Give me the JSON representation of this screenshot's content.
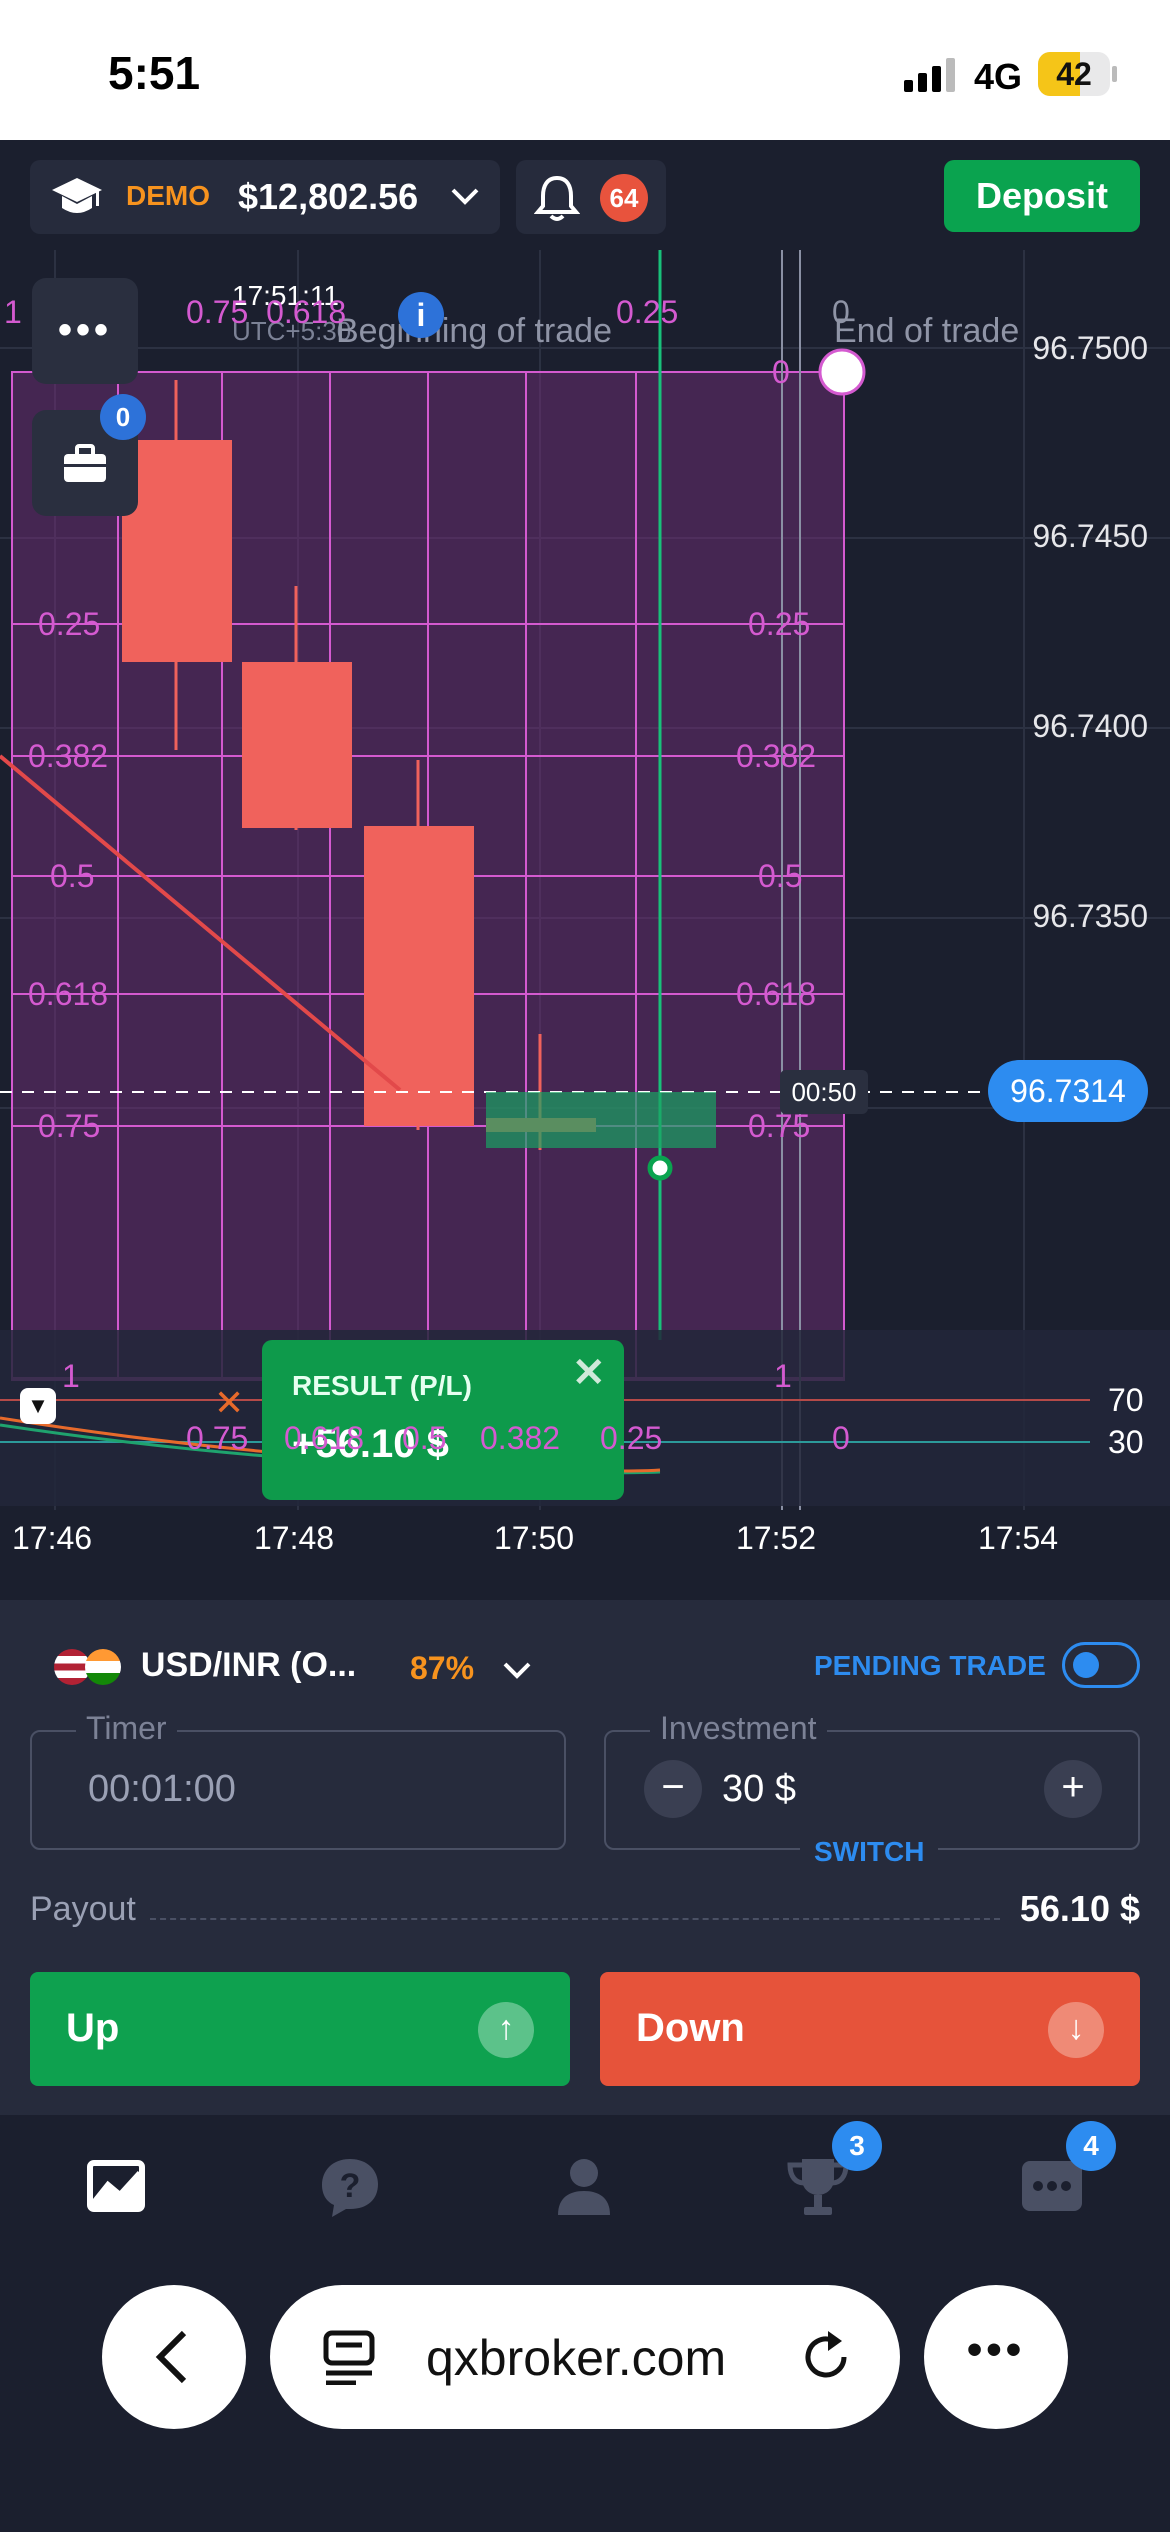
{
  "status_bar": {
    "time": "5:51",
    "network": "4G",
    "battery": "42"
  },
  "topbar": {
    "account_mode": "DEMO",
    "balance": "$12,802.56",
    "notifications_count": "64",
    "deposit_label": "Deposit",
    "icons": [
      "graduation-cap-icon",
      "chevron-down-icon",
      "bell-icon"
    ]
  },
  "chart": {
    "price_axis": [
      "96.7500",
      "96.7450",
      "96.7400",
      "96.7350"
    ],
    "current_price": "96.7314",
    "countdown": "00:50",
    "time_axis": [
      "17:46",
      "17:48",
      "17:50",
      "17:52",
      "17:54"
    ],
    "fib_levels_left": [
      "0.25",
      "0.382",
      "0.5",
      "0.618",
      "0.75",
      "1"
    ],
    "fib_levels_right": [
      "0",
      "0.25",
      "0.382",
      "0.5",
      "0.618",
      "0.75",
      "1"
    ],
    "fib_bottom_row": [
      "0.75",
      "0.618",
      "0.5",
      "0.382",
      "0.25",
      "0"
    ],
    "top_labels": {
      "clock": "17:51:11",
      "timezone": "UTC+5:30",
      "beginning": "Beginning of trade",
      "end": "End of trade",
      "partial_left": "1",
      "partial_fibs": "0.75  0.618",
      "partial_right": "0.25",
      "partial_zero": "0"
    },
    "oscillator_levels": [
      "70",
      "30"
    ],
    "portfolio_count": "0",
    "colors": {
      "bearish": "#f0625c",
      "fib": "#c94ec8",
      "trend": "#e2494a",
      "accent": "#2d8cf0"
    }
  },
  "result_popup": {
    "label": "RESULT (P/L)",
    "value": "+56.10 $"
  },
  "trade_panel": {
    "pair": "USD/INR (O...",
    "payout_percent": "87%",
    "pending_label": "PENDING TRADE",
    "timer_label": "Timer",
    "timer_value": "00:01:00",
    "investment_label": "Investment",
    "investment_value": "30 $",
    "switch_label": "SWITCH",
    "payout_label": "Payout",
    "payout_value": "56.10 $",
    "up_label": "Up",
    "down_label": "Down",
    "up_color": "#0ea14f",
    "down_color": "#e6533a"
  },
  "bottom_nav": {
    "items": [
      "chart-icon",
      "help-icon",
      "profile-icon",
      "trophy-icon",
      "chat-icon"
    ],
    "trophy_badge": "3",
    "chat_badge": "4"
  },
  "browser": {
    "url": "qxbroker.com"
  }
}
